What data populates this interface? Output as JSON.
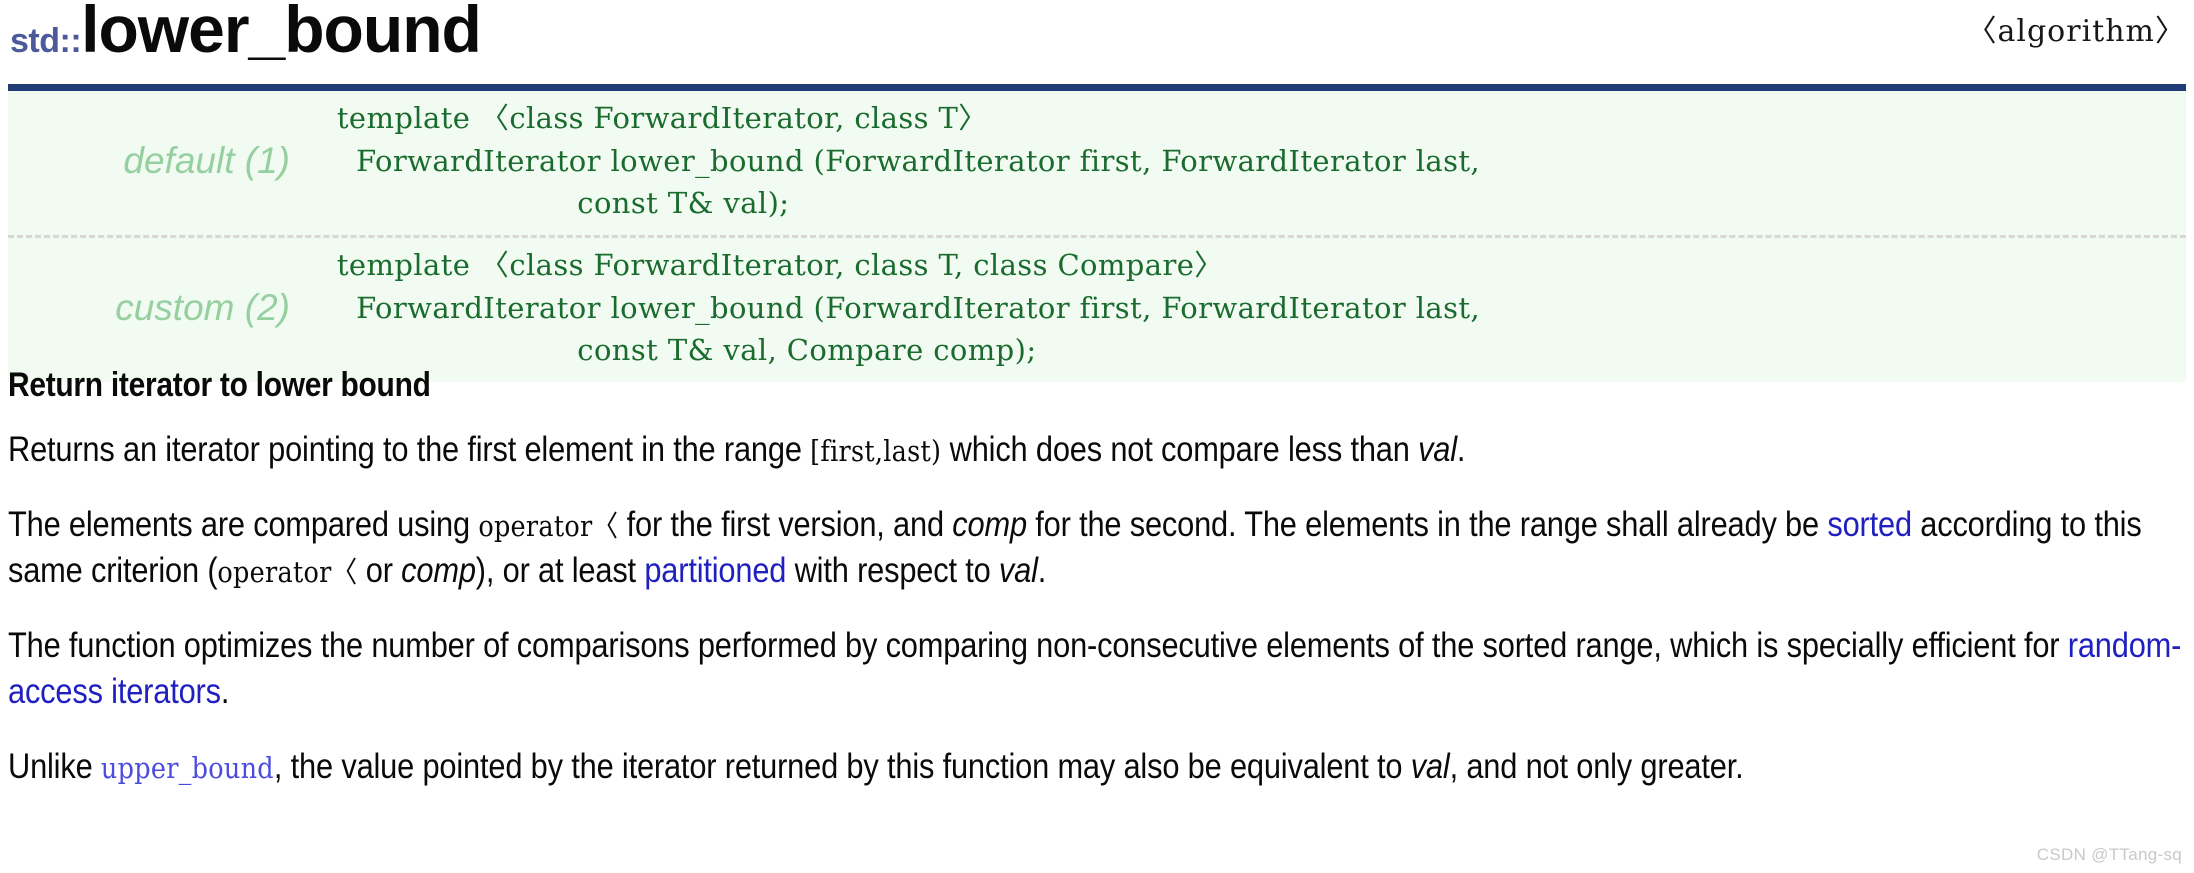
{
  "header": {
    "namespace": "std::",
    "function_name": "lower_bound",
    "include_header": "〈algorithm〉",
    "rule_color": "#1f3c77",
    "namespace_color": "#4c5a9c"
  },
  "prototypes": {
    "background_color": "#f2fbf2",
    "code_color": "#1a6b2e",
    "label_color": "#96cfa0",
    "rows": [
      {
        "label": "default (1)",
        "code": "   template 〈class ForwardIterator, class T〉\n     ForwardIterator lower_bound (ForwardIterator first, ForwardIterator last,\n                            const T& val);"
      },
      {
        "label": "custom (2)",
        "code": "   template 〈class ForwardIterator, class T, class Compare〉\n     ForwardIterator lower_bound (ForwardIterator first, ForwardIterator last,\n                            const T& val, Compare comp);"
      }
    ]
  },
  "body": {
    "section_heading": "Return iterator to lower bound",
    "link_color": "#2020c0",
    "code_link_color": "#4b4be0",
    "paragraph1": {
      "t1": "Returns an iterator pointing to the first element in the range ",
      "code1": "[first,last)",
      "t2": " which does not compare less than ",
      "em1": "val",
      "t3": "."
    },
    "paragraph2": {
      "t1": "The elements are compared using ",
      "code1": "operator〈",
      "t2": " for the first version, and ",
      "em1": "comp",
      "t3": " for the second. The elements in the range shall already be ",
      "link1": "sorted",
      "t4": " according to this same criterion (",
      "code2": "operator〈",
      "t5": " or ",
      "em2": "comp",
      "t6": "), or at least ",
      "link2": "partitioned",
      "t7": " with respect to ",
      "em3": "val",
      "t8": "."
    },
    "paragraph3": {
      "t1": "The function optimizes the number of comparisons performed by comparing non-consecutive elements of the sorted range, which is specially efficient for ",
      "link1": "random-access iterators",
      "t2": "."
    },
    "paragraph4": {
      "t1": "Unlike ",
      "codelink1": "upper_bound",
      "t2": ", the value pointed by the iterator returned by this function may also be equivalent to ",
      "em1": "val",
      "t3": ", and not only greater."
    }
  },
  "watermark": {
    "text": "CSDN @TTang-sq"
  }
}
